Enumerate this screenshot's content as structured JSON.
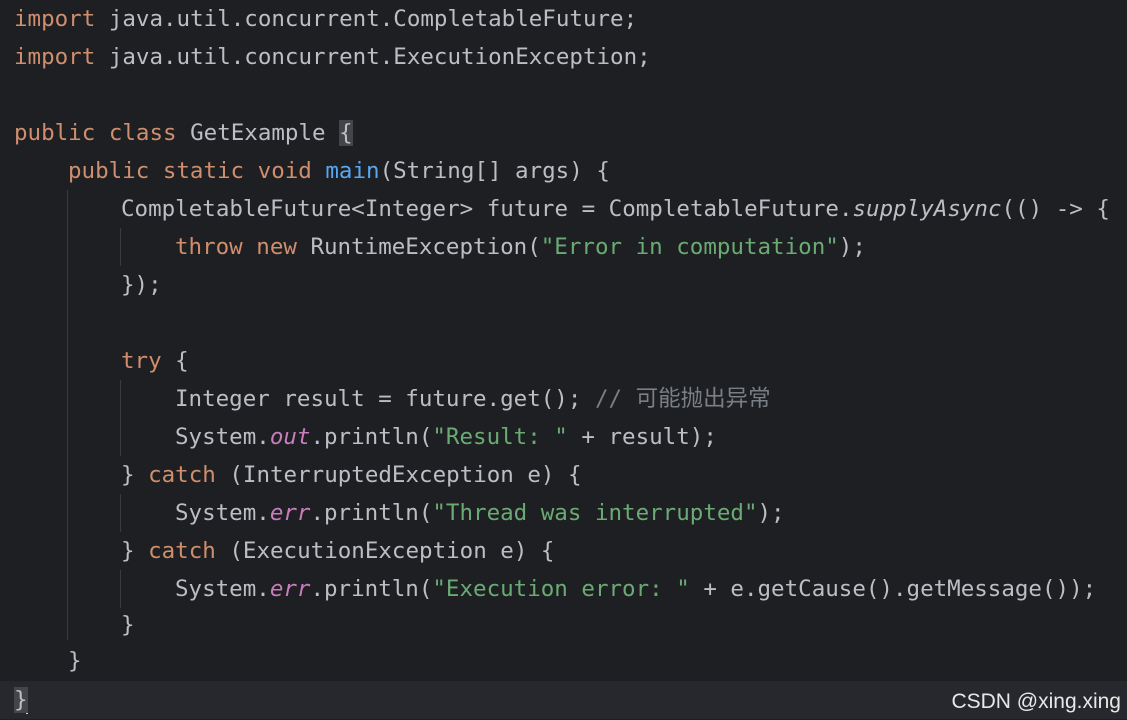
{
  "code": {
    "l1_import": "import",
    "l1_rest": " java.util.concurrent.CompletableFuture;",
    "l2_import": "import",
    "l2_rest": " java.util.concurrent.ExecutionException;",
    "l4_public": "public",
    "l4_class": "class",
    "l4_name": " GetExample ",
    "l4_brace": "{",
    "l5_public": "public",
    "l5_static": "static",
    "l5_void": "void",
    "l5_main": "main",
    "l5_rest": "(String[] args) {",
    "l6_pre": "CompletableFuture<Integer> future = CompletableFuture.",
    "l6_method": "supplyAsync",
    "l6_post": "(() -> {",
    "l7_throw": "throw",
    "l7_new": "new",
    "l7_cls": " RuntimeException(",
    "l7_str": "\"Error in computation\"",
    "l7_end": ");",
    "l8": "});",
    "l10_try": "try",
    "l10_rest": " {",
    "l11_code": "Integer result = future.get(); ",
    "l11_comment": "// 可能抛出异常",
    "l12_pre": "System.",
    "l12_out": "out",
    "l12_mid": ".println(",
    "l12_str": "\"Result: \"",
    "l12_end": " + result);",
    "l13_pre": "} ",
    "l13_catch": "catch",
    "l13_rest": " (InterruptedException e) {",
    "l14_pre": "System.",
    "l14_err": "err",
    "l14_mid": ".println(",
    "l14_str": "\"Thread was interrupted\"",
    "l14_end": ");",
    "l15_pre": "} ",
    "l15_catch": "catch",
    "l15_rest": " (ExecutionException e) {",
    "l16_pre": "System.",
    "l16_err": "err",
    "l16_mid": ".println(",
    "l16_str": "\"Execution error: \"",
    "l16_end": " + e.getCause().getMessage());",
    "l17": "}",
    "l18": "}",
    "l19": "}"
  },
  "watermark": "CSDN @xing.xing",
  "colors": {
    "background": "#1e1f22",
    "keyword": "#cf8e6d",
    "function": "#56a8f5",
    "string": "#6aab73",
    "static_field": "#c77dbb",
    "comment": "#7a7e85",
    "text": "#bcbec4"
  }
}
